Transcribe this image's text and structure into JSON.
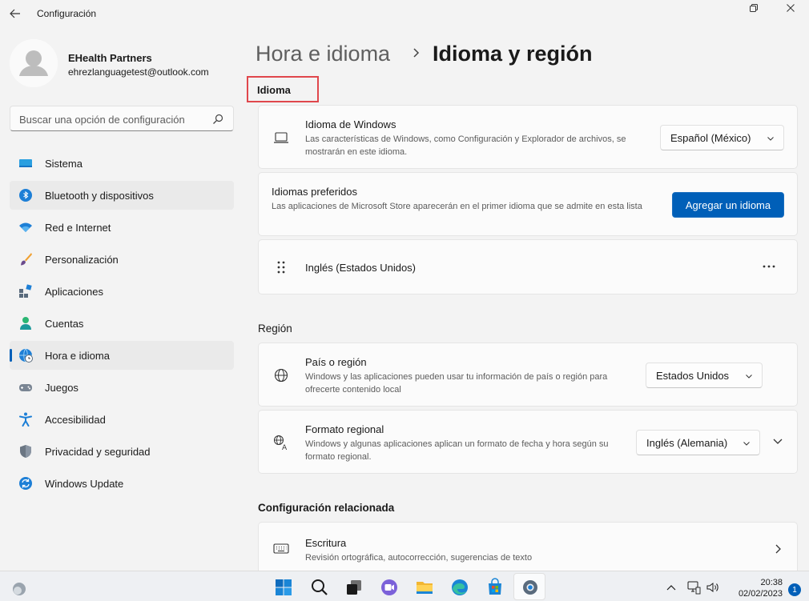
{
  "window": {
    "title": "Configuración"
  },
  "profile": {
    "name": "EHealth Partners",
    "email": "ehrezlanguagetest@outlook.com"
  },
  "search": {
    "placeholder": "Buscar una opción de configuración"
  },
  "nav": {
    "items": [
      {
        "label": "Sistema",
        "icon": "system-icon"
      },
      {
        "label": "Bluetooth y dispositivos",
        "icon": "bluetooth-icon"
      },
      {
        "label": "Red e Internet",
        "icon": "wifi-icon"
      },
      {
        "label": "Personalización",
        "icon": "brush-icon"
      },
      {
        "label": "Aplicaciones",
        "icon": "apps-icon"
      },
      {
        "label": "Cuentas",
        "icon": "accounts-icon"
      },
      {
        "label": "Hora e idioma",
        "icon": "time-language-icon"
      },
      {
        "label": "Juegos",
        "icon": "gamepad-icon"
      },
      {
        "label": "Accesibilidad",
        "icon": "accessibility-icon"
      },
      {
        "label": "Privacidad y seguridad",
        "icon": "shield-icon"
      },
      {
        "label": "Windows Update",
        "icon": "update-icon"
      }
    ],
    "selected_index": 6
  },
  "breadcrumb": {
    "parent": "Hora e idioma",
    "current": "Idioma y región"
  },
  "language_section": {
    "title": "Idioma",
    "windows_language": {
      "title": "Idioma de Windows",
      "description": "Las características de Windows, como Configuración y Explorador de archivos, se mostrarán en este idioma.",
      "value": "Español (México)"
    },
    "preferred": {
      "title": "Idiomas preferidos",
      "description": "Las aplicaciones de Microsoft Store aparecerán en el primer idioma que se admite en esta lista",
      "button": "Agregar un idioma"
    },
    "languages": [
      {
        "name": "Inglés (Estados Unidos)"
      }
    ]
  },
  "region_section": {
    "title": "Región",
    "country": {
      "title": "País o región",
      "description": "Windows y las aplicaciones pueden usar tu información de país o región para ofrecerte contenido local",
      "value": "Estados Unidos"
    },
    "format": {
      "title": "Formato regional",
      "description": "Windows y algunas aplicaciones aplican un formato de fecha y hora según su formato regional.",
      "value": "Inglés (Alemania)"
    }
  },
  "related_section": {
    "title": "Configuración relacionada",
    "typing": {
      "title": "Escritura",
      "description": "Revisión ortográfica, autocorrección, sugerencias de texto"
    }
  },
  "taskbar": {
    "time": "20:38",
    "date": "02/02/2023",
    "notifications": "1"
  },
  "colors": {
    "accent": "#005fb8",
    "highlight_box": "#e0474c"
  }
}
